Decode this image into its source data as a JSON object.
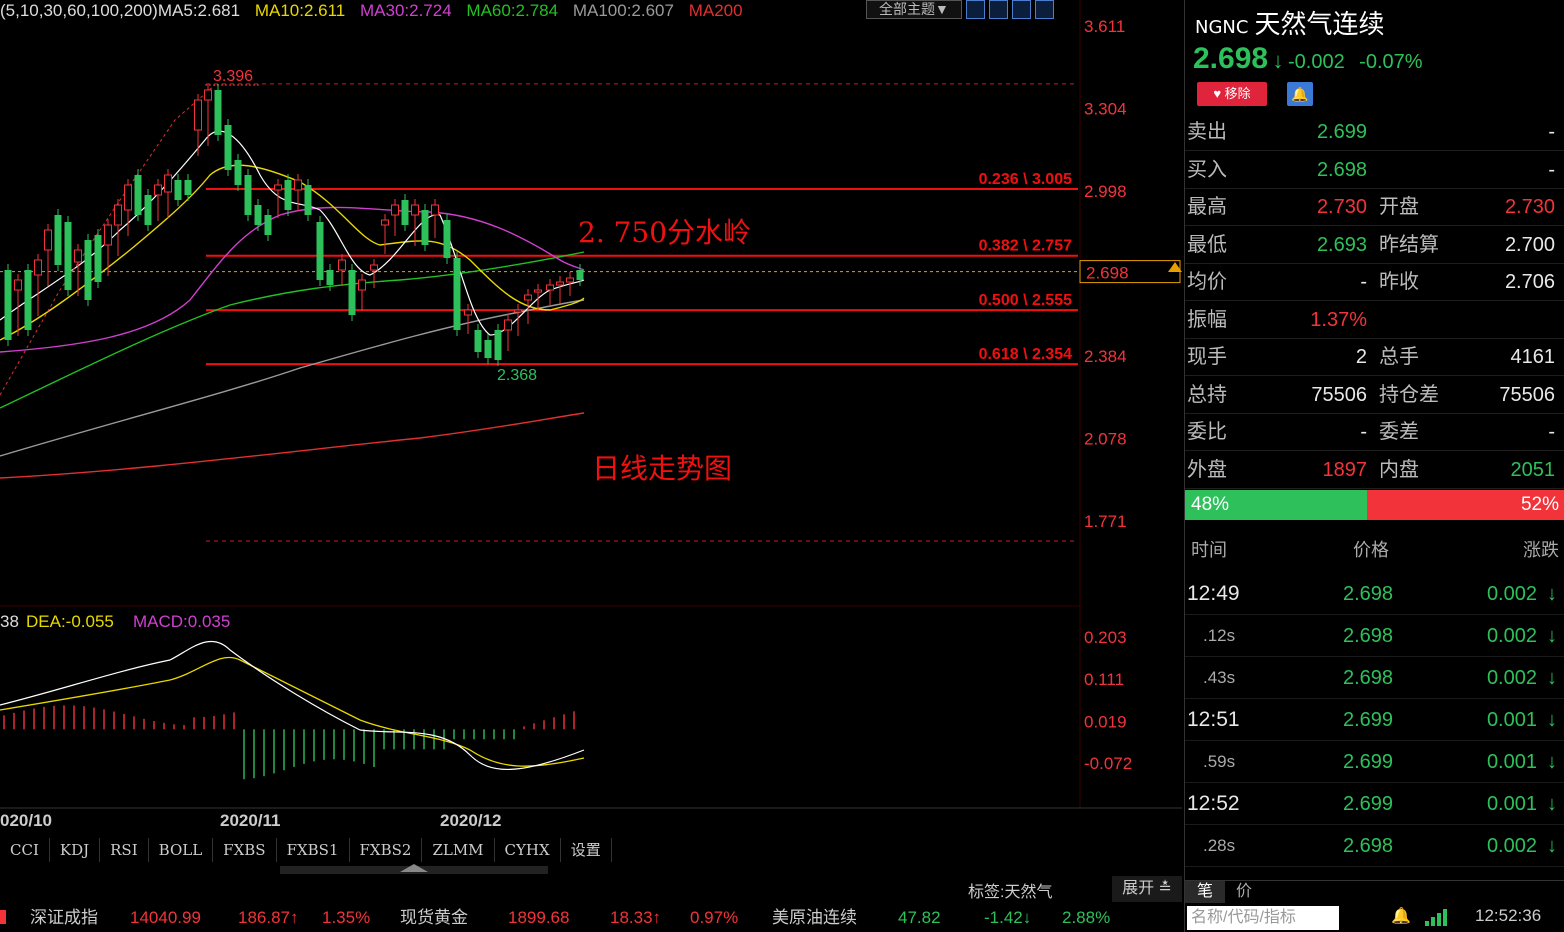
{
  "ma_line": {
    "params": "(5,10,30,60,100,200)",
    "ma5": "MA5:2.681",
    "ma10": "MA10:2.611",
    "ma30": "MA30:2.724",
    "ma60": "MA60:2.784",
    "ma100": "MA100:2.607",
    "ma200": "MA200"
  },
  "toolbar": {
    "theme_label": "全部主题▼"
  },
  "price_axis": [
    "3.611",
    "3.304",
    "2.998",
    "2.691",
    "2.384",
    "2.078",
    "1.771"
  ],
  "current_price_tag": "2.698",
  "fib_levels": [
    {
      "label": "0.236 \\ 3.005",
      "value": 3.005
    },
    {
      "label": "0.382 \\ 2.757",
      "value": 2.757
    },
    {
      "label": "0.500 \\ 2.555",
      "value": 2.555
    },
    {
      "label": "0.618 \\ 2.354",
      "value": 2.354
    }
  ],
  "annotations": {
    "high": "3.396",
    "low": "2.368",
    "watershed": "2. 750分水岭",
    "chart_title": "日线走势图"
  },
  "macd": {
    "dif_partial": "38",
    "dea": "DEA:-0.055",
    "macd": "MACD:0.035",
    "axis": [
      "0.203",
      "0.111",
      "0.019",
      "-0.072"
    ]
  },
  "date_axis": [
    "020/10",
    "2020/11",
    "2020/12"
  ],
  "indicator_tabs": [
    "CCI",
    "KDJ",
    "RSI",
    "BOLL",
    "FXBS",
    "FXBS1",
    "FXBS2",
    "ZLMM",
    "CYHX",
    "设置"
  ],
  "tag_bar": {
    "tag": "标签:天然气",
    "expand": "展开 ≛"
  },
  "quote": {
    "code": "NGNC",
    "name": "天然气连续",
    "price": "2.698",
    "arrow": "↓",
    "change": "-0.002",
    "pct": "-0.07%",
    "remove_label": "移除",
    "rows": [
      {
        "l1": "卖出",
        "v1": "2.699",
        "l2": "",
        "v2": "-",
        "c1": "grn",
        "c2": "wht"
      },
      {
        "l1": "买入",
        "v1": "2.698",
        "l2": "",
        "v2": "-",
        "c1": "grn",
        "c2": "wht"
      },
      {
        "l1": "最高",
        "v1": "2.730",
        "l2": "开盘",
        "v2": "2.730",
        "c1": "red",
        "c2": "red"
      },
      {
        "l1": "最低",
        "v1": "2.693",
        "l2": "昨结算",
        "v2": "2.700",
        "c1": "grn",
        "c2": "wht"
      },
      {
        "l1": "均价",
        "v1": "-",
        "l2": "昨收",
        "v2": "2.706",
        "c1": "wht",
        "c2": "wht"
      },
      {
        "l1": "振幅",
        "v1": "1.37%",
        "l2": "",
        "v2": "",
        "c1": "red",
        "c2": "wht"
      },
      {
        "l1": "现手",
        "v1": "2",
        "l2": "总手",
        "v2": "4161",
        "c1": "wht",
        "c2": "wht"
      },
      {
        "l1": "总持",
        "v1": "75506",
        "l2": "持仓差",
        "v2": "75506",
        "c1": "wht",
        "c2": "wht"
      },
      {
        "l1": "委比",
        "v1": "-",
        "l2": "委差",
        "v2": "-",
        "c1": "wht",
        "c2": "wht"
      },
      {
        "l1": "外盘",
        "v1": "1897",
        "l2": "内盘",
        "v2": "2051",
        "c1": "red",
        "c2": "grn"
      }
    ],
    "buy_ratio": "48%",
    "sell_ratio": "52%"
  },
  "ticks": {
    "headers": [
      "时间",
      "价格",
      "涨跌"
    ],
    "rows": [
      {
        "time": "12:49",
        "price": "2.698",
        "chg": "0.002",
        "big": true
      },
      {
        "time": ".12s",
        "price": "2.698",
        "chg": "0.002",
        "big": false
      },
      {
        "time": ".43s",
        "price": "2.698",
        "chg": "0.002",
        "big": false
      },
      {
        "time": "12:51",
        "price": "2.699",
        "chg": "0.001",
        "big": true
      },
      {
        "time": ".59s",
        "price": "2.699",
        "chg": "0.001",
        "big": false
      },
      {
        "time": "12:52",
        "price": "2.699",
        "chg": "0.001",
        "big": true
      },
      {
        "time": ".28s",
        "price": "2.698",
        "chg": "0.002",
        "big": false
      }
    ],
    "tab1": "笔",
    "tab2": "价"
  },
  "status": {
    "idx1": "深证成指",
    "idx1_val": "14040.99",
    "idx1_chg": "186.87↑",
    "idx1_pct": "1.35%",
    "idx2": "现货黄金",
    "idx2_val": "1899.68",
    "idx2_chg": "18.33↑",
    "idx2_pct": "0.97%",
    "idx3": "美原油连续",
    "idx3_val": "47.82",
    "idx3_chg": "-1.42↓",
    "idx3_pct": "2.88%",
    "search_placeholder": "名称/代码/指标",
    "time": "12:52:36"
  },
  "colors": {
    "up": "#f2343a",
    "down": "#2ec05b",
    "ma5": "#ffffff",
    "ma10": "#e8d800",
    "ma30": "#d040d0",
    "ma60": "#22c022",
    "ma100": "#9a9a9a",
    "ma200": "#e03030"
  }
}
